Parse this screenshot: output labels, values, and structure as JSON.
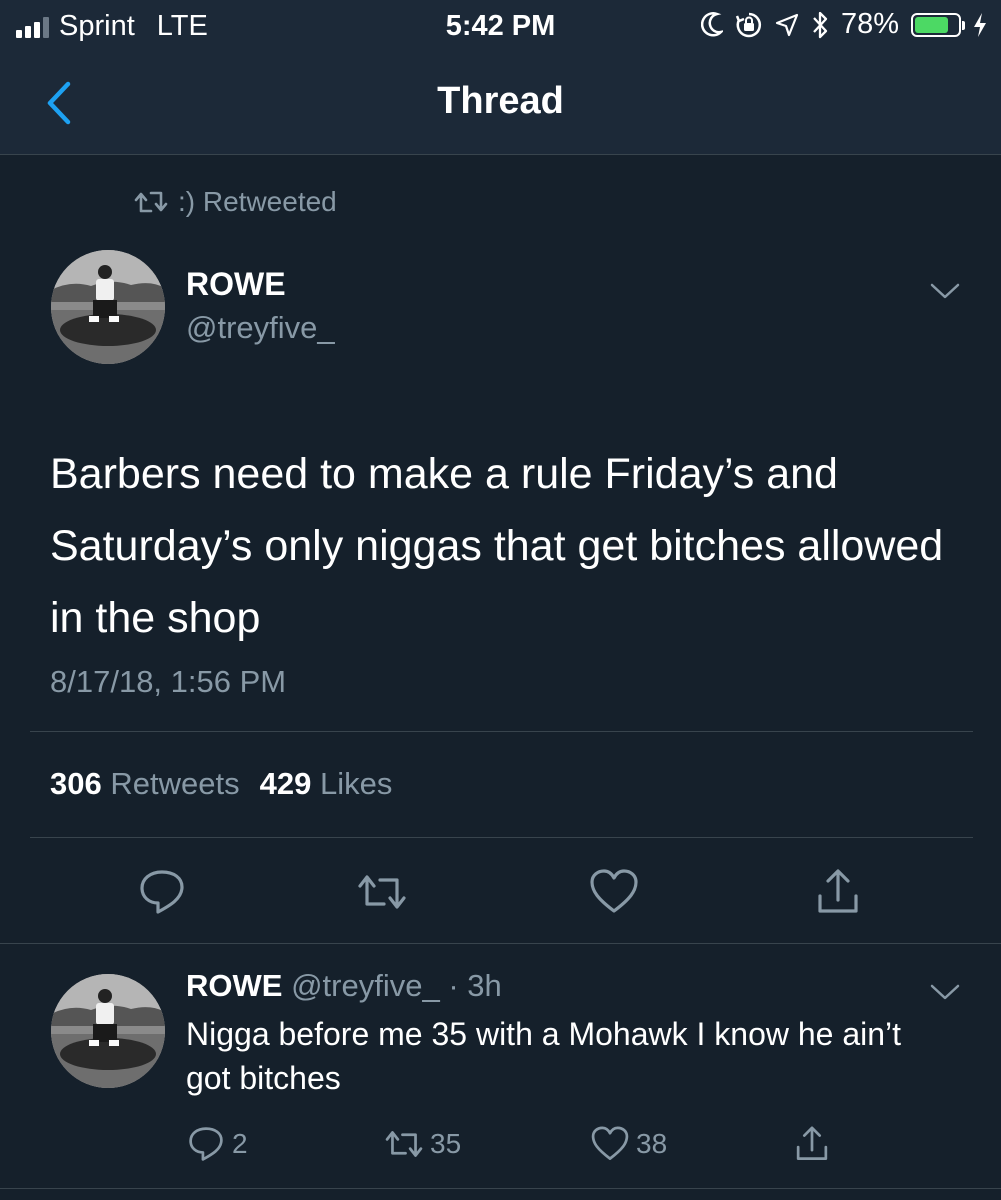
{
  "status_bar": {
    "carrier": "Sprint",
    "network": "LTE",
    "time": "5:42 PM",
    "battery": "78%",
    "battery_level": 0.78,
    "icons": [
      "moon-icon",
      "rotation-lock-icon",
      "location-icon",
      "bluetooth-icon",
      "battery-icon",
      "charging-icon"
    ]
  },
  "nav": {
    "title": "Thread",
    "back_icon": "chevron-left-icon"
  },
  "retweet_context": {
    "label": ":) Retweeted",
    "icon": "retweet-icon"
  },
  "tweet": {
    "author_name": "ROWE",
    "author_handle": "@treyfive_",
    "text": "Barbers need to make a rule Friday’s and Saturday’s only niggas that get bitches allowed in the shop",
    "timestamp": "8/17/18, 1:56 PM",
    "retweets_count": "306",
    "retweets_label": "Retweets",
    "likes_count": "429",
    "likes_label": "Likes",
    "actions": [
      "reply-icon",
      "retweet-icon",
      "like-icon",
      "share-icon"
    ]
  },
  "reply": {
    "author_name": "ROWE",
    "author_handle": "@treyfive_",
    "time_sep": "·",
    "age": "3h",
    "text": "Nigga before me 35 with a Mohawk I know he ain’t got bitches",
    "reply_count": "2",
    "retweet_count": "35",
    "like_count": "38"
  },
  "colors": {
    "background": "#15202b",
    "bar_background": "#1c2938",
    "secondary_text": "#8899a6",
    "accent": "#1da1f2",
    "battery_fill": "#4cd964"
  }
}
